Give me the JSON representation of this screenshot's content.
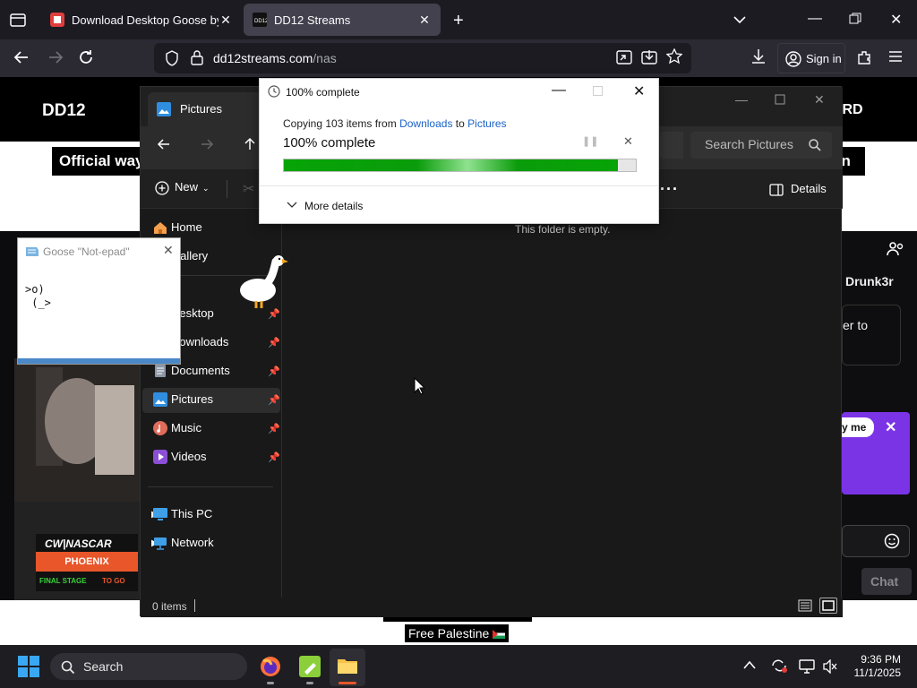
{
  "browser": {
    "tabs": [
      {
        "label": "Download Desktop Goose by sa",
        "active": false
      },
      {
        "label": "DD12 Streams",
        "active": true
      }
    ],
    "url_host": "dd12streams.com",
    "url_path": "/nas",
    "sign_in_label": "Sign in"
  },
  "site": {
    "logo": "DD12",
    "header_right": "ORD",
    "banner": "Official way",
    "banner_right": "en",
    "user": "Drunk3r",
    "tip": "er to",
    "follow": "y me",
    "chat_label": "Chat",
    "footer_partial": "Free Palestine",
    "side_badge": "CW|NASCAR",
    "side_badge_sub": "PHOENIX",
    "side_badge_stage": "FINAL STAGE",
    "side_badge_togo": "TO GO"
  },
  "explorer": {
    "tab_title": "Pictures",
    "search_placeholder": "Search Pictures",
    "new_label": "New",
    "details_label": "Details",
    "nav_items": [
      {
        "label": "Home",
        "pinned": false
      },
      {
        "label": "Gallery",
        "pinned": false
      },
      {
        "label": "Desktop",
        "pinned": true
      },
      {
        "label": "Downloads",
        "pinned": true
      },
      {
        "label": "Documents",
        "pinned": true
      },
      {
        "label": "Pictures",
        "pinned": true,
        "selected": true
      },
      {
        "label": "Music",
        "pinned": true
      },
      {
        "label": "Videos",
        "pinned": true
      },
      {
        "label": "This PC",
        "pinned": false
      },
      {
        "label": "Network",
        "pinned": false
      }
    ],
    "empty_message": "This folder is empty.",
    "status": "0 items"
  },
  "copy_dialog": {
    "title": "100% complete",
    "copy_prefix": "Copying 103 items from",
    "from": "Downloads",
    "to_word": "to",
    "to": "Pictures",
    "percent_label": "100% complete",
    "progress": 0.95,
    "more_details": "More details"
  },
  "notepad": {
    "title": "Goose \"Not-epad\"",
    "text": ">o)\n (_>"
  },
  "taskbar": {
    "search_label": "Search",
    "time": "9:36 PM",
    "date": "11/1/2025"
  },
  "colors": {
    "accent_blue": "#1a63c7",
    "progress_green": "#06a406",
    "purple": "#7b33e6"
  }
}
